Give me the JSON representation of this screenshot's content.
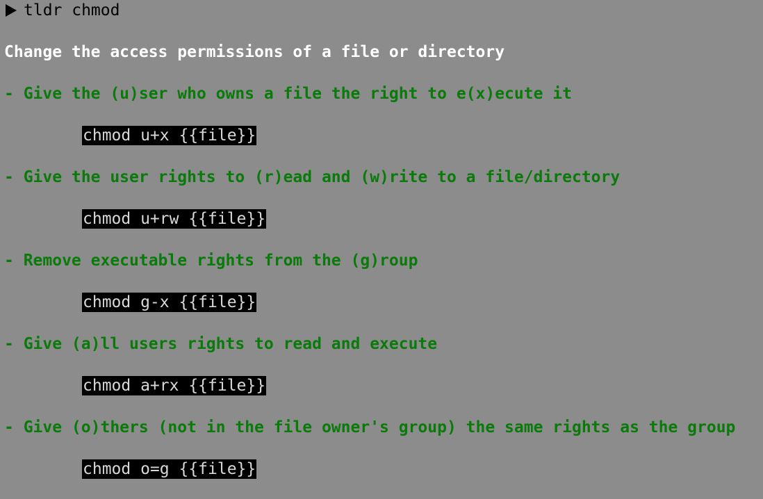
{
  "terminal": {
    "command": "tldr chmod",
    "description": "Change the access permissions of a file or directory",
    "examples": [
      {
        "description": "- Give the (u)ser who owns a file the right to e(x)ecute it",
        "command": "chmod u+x {{file}}"
      },
      {
        "description": "- Give the user rights to (r)ead and (w)rite to a file/directory",
        "command": "chmod u+rw {{file}}"
      },
      {
        "description": "- Remove executable rights from the (g)roup",
        "command": "chmod g-x {{file}}"
      },
      {
        "description": "- Give (a)ll users rights to read and execute",
        "command": "chmod a+rx {{file}}"
      },
      {
        "description": "- Give (o)thers (not in the file owner's group) the same rights as the group",
        "command": "chmod o=g {{file}}"
      }
    ]
  },
  "colors": {
    "background": "#8c8c8c",
    "description_text": "#ffffff",
    "example_text": "#0a7a0a",
    "code_background": "#000000",
    "code_text": "#d8d8d8"
  },
  "icons": {
    "prompt": "prompt-triangle-icon"
  }
}
